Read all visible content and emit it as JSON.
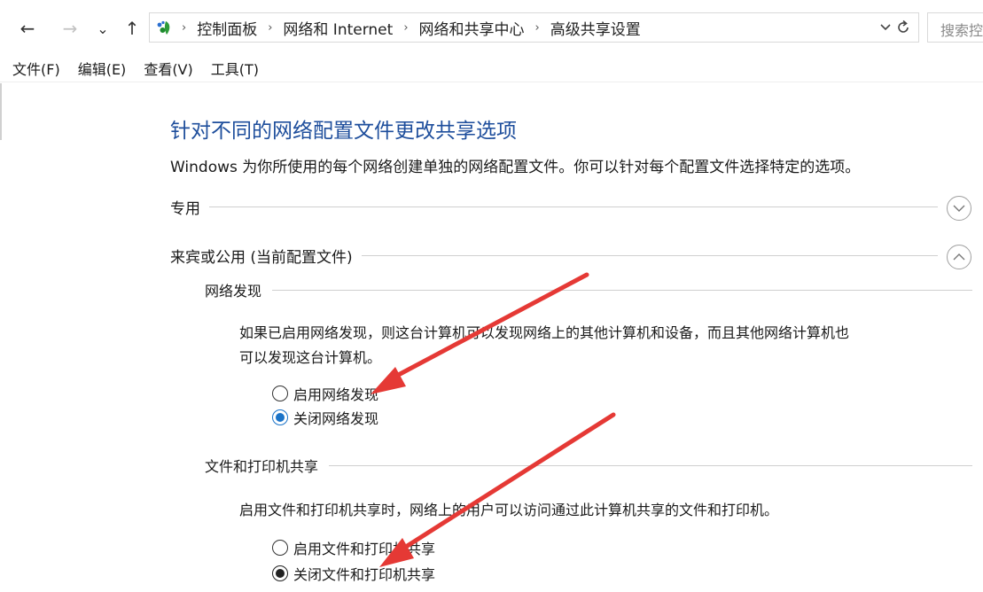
{
  "nav": {
    "back_icon": "back-arrow-icon",
    "forward_icon": "forward-arrow-icon",
    "recent_icon": "chevron-down-icon",
    "up_icon": "up-arrow-icon",
    "back_glyph": "←",
    "forward_glyph": "→",
    "recent_glyph": "⌄",
    "up_glyph": "↑"
  },
  "address_bar": {
    "icon": "control-panel-icon",
    "breadcrumbs": [
      "控制面板",
      "网络和 Internet",
      "网络和共享中心",
      "高级共享设置"
    ],
    "separator": "›"
  },
  "search": {
    "placeholder": "搜索控"
  },
  "menu": [
    "文件(F)",
    "编辑(E)",
    "查看(V)",
    "工具(T)"
  ],
  "main": {
    "heading": "针对不同的网络配置文件更改共享选项",
    "description": "Windows 为你所使用的每个网络创建单独的网络配置文件。你可以针对每个配置文件选择特定的选项。",
    "profiles": [
      {
        "label": "专用",
        "state": "collapsed"
      },
      {
        "label": "来宾或公用 (当前配置文件)",
        "state": "expanded"
      }
    ],
    "network_discovery": {
      "title": "网络发现",
      "text_line1": "如果已启用网络发现，则这台计算机可以发现网络上的其他计算机和设备，而且其他网络计算机也",
      "text_line2": "可以发现这台计算机。",
      "options": [
        {
          "label": "启用网络发现",
          "checked": false
        },
        {
          "label": "关闭网络发现",
          "checked": true
        }
      ]
    },
    "file_printer_sharing": {
      "title": "文件和打印机共享",
      "text": "启用文件和打印机共享时，网络上的用户可以访问通过此计算机共享的文件和打印机。",
      "options": [
        {
          "label": "启用文件和打印机共享",
          "checked": false
        },
        {
          "label": "关闭文件和打印机共享",
          "checked": true
        }
      ]
    }
  },
  "colors": {
    "heading": "#1e4e9c",
    "radio_accent": "#1a73c8",
    "annotation_arrow": "#e53935"
  }
}
